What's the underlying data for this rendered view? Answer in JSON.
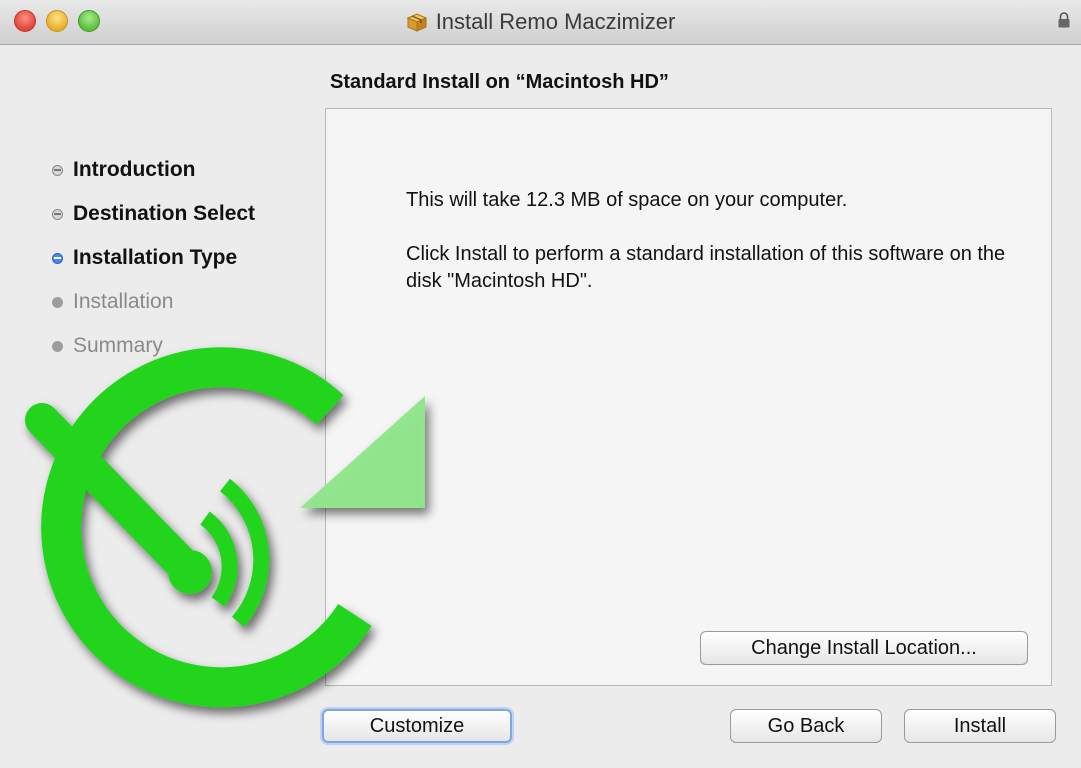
{
  "window": {
    "title": "Install Remo Maczimizer"
  },
  "main": {
    "heading": "Standard Install on “Macintosh HD”"
  },
  "steps": [
    {
      "label": "Introduction",
      "state": "done"
    },
    {
      "label": "Destination Select",
      "state": "done"
    },
    {
      "label": "Installation Type",
      "state": "current"
    },
    {
      "label": "Installation",
      "state": "future"
    },
    {
      "label": "Summary",
      "state": "future"
    }
  ],
  "content": {
    "line1": "This will take 12.3 MB of space on your computer.",
    "line2": "Click Install to perform a standard installation of this software on the disk \"Macintosh HD\".",
    "change_location": "Change Install Location..."
  },
  "buttons": {
    "customize": "Customize",
    "go_back": "Go Back",
    "install": "Install"
  },
  "colors": {
    "accent": "#4a86f0",
    "logo_green": "#22d41b",
    "logo_arrow": "#8ee68a"
  },
  "icons": {
    "title_icon": "package-icon",
    "lock": "lock-icon",
    "logo": "remo-maczimizer-logo"
  }
}
